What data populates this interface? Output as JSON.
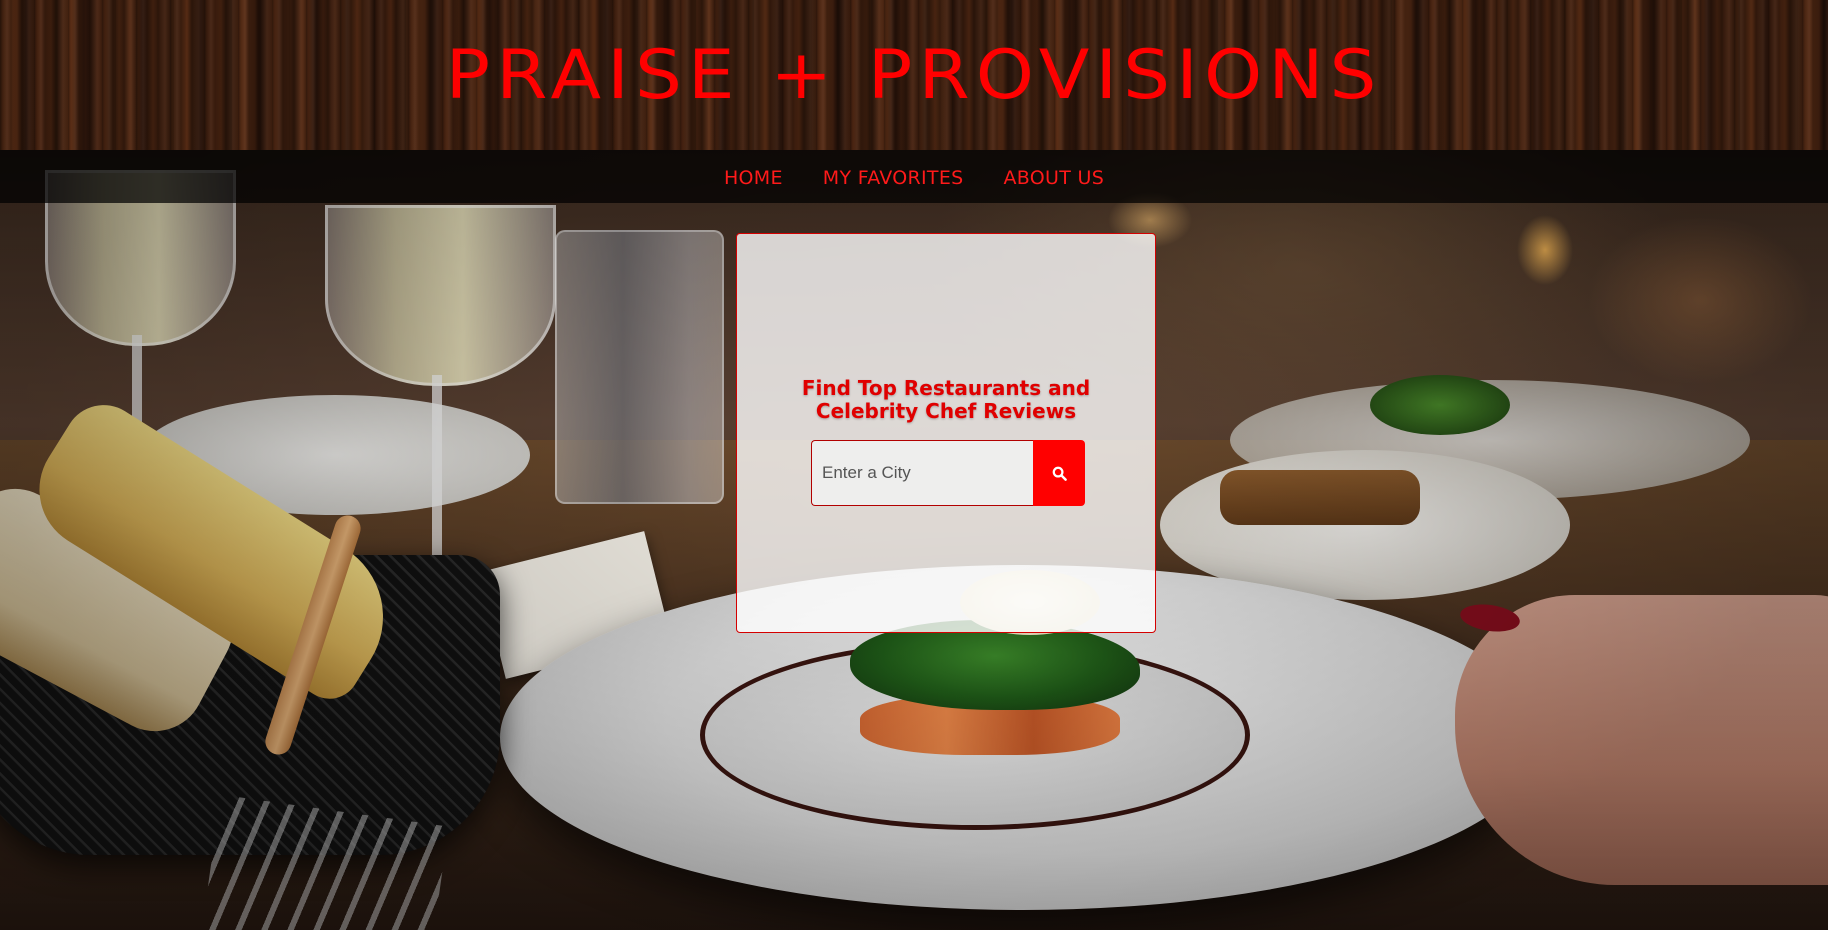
{
  "header": {
    "title": "PRAISE + PROVISIONS"
  },
  "nav": {
    "items": [
      {
        "label": "HOME"
      },
      {
        "label": "MY FAVORITES"
      },
      {
        "label": "ABOUT US"
      }
    ]
  },
  "search": {
    "heading": "Find Top Restaurants and Celebrity Chef Reviews",
    "placeholder": "Enter a City",
    "value": "",
    "button_icon": "search-icon"
  },
  "colors": {
    "accent": "#ff0000",
    "nav_bg": "#000000",
    "card_bg": "#ffffff",
    "header_wood": "#3d1f0f"
  }
}
